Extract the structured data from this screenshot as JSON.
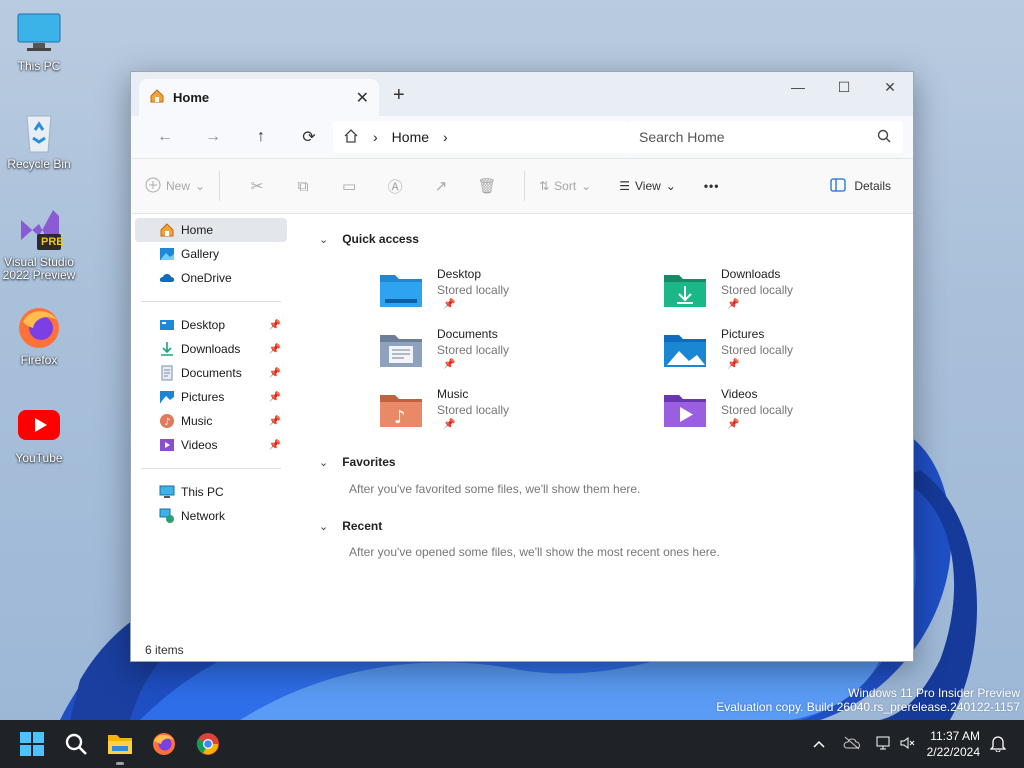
{
  "desktop": {
    "icons": [
      {
        "label": "This PC",
        "icon": "monitor-icon"
      },
      {
        "label": "Recycle Bin",
        "icon": "recycle-bin-icon"
      },
      {
        "label": "Visual Studio 2022 Preview",
        "icon": "visual-studio-icon",
        "badge": "PRE"
      },
      {
        "label": "Firefox",
        "icon": "firefox-icon"
      },
      {
        "label": "YouTube",
        "icon": "youtube-icon"
      }
    ],
    "watermark": {
      "line1": "Windows 11 Pro Insider Preview",
      "line2": "Evaluation copy. Build 26040.rs_prerelease.240122-1157"
    }
  },
  "window": {
    "tab": {
      "label": "Home",
      "icon": "home-icon",
      "close": "✕"
    },
    "new_tab": "+",
    "controls": {
      "minimize": "—",
      "maximize": "☐",
      "close": "✕"
    },
    "address": {
      "back": "←",
      "forward": "→",
      "up": "↑",
      "refresh": "⟳",
      "crumb": "Home",
      "sep": "›",
      "search_placeholder": "Search Home"
    },
    "toolbar": {
      "new_label": "New",
      "sort_label": "Sort",
      "view_label": "View",
      "more": "•••",
      "details_label": "Details"
    },
    "sidebar": {
      "top": [
        {
          "label": "Home",
          "icon": "home-icon",
          "active": true
        },
        {
          "label": "Gallery",
          "icon": "gallery-icon"
        },
        {
          "label": "OneDrive",
          "icon": "onedrive-icon"
        }
      ],
      "pinned": [
        {
          "label": "Desktop",
          "icon": "desktop-folder-icon"
        },
        {
          "label": "Downloads",
          "icon": "download-icon"
        },
        {
          "label": "Documents",
          "icon": "documents-icon"
        },
        {
          "label": "Pictures",
          "icon": "pictures-icon"
        },
        {
          "label": "Music",
          "icon": "music-icon"
        },
        {
          "label": "Videos",
          "icon": "videos-icon"
        }
      ],
      "bottom": [
        {
          "label": "This PC",
          "icon": "monitor-icon"
        },
        {
          "label": "Network",
          "icon": "network-icon"
        }
      ]
    },
    "main": {
      "quick_access": {
        "title": "Quick access",
        "items": [
          {
            "name": "Desktop",
            "sub": "Stored locally",
            "color": "#1e88d6"
          },
          {
            "name": "Downloads",
            "sub": "Stored locally",
            "color": "#1aa37a"
          },
          {
            "name": "Documents",
            "sub": "Stored locally",
            "color": "#7a8fa8"
          },
          {
            "name": "Pictures",
            "sub": "Stored locally",
            "color": "#1a86d4"
          },
          {
            "name": "Music",
            "sub": "Stored locally",
            "color": "#e07a5a"
          },
          {
            "name": "Videos",
            "sub": "Stored locally",
            "color": "#8a4fd0"
          }
        ]
      },
      "favorites": {
        "title": "Favorites",
        "empty": "After you've favorited some files, we'll show them here."
      },
      "recent": {
        "title": "Recent",
        "empty": "After you've opened some files, we'll show the most recent ones here."
      }
    },
    "status": "6 items"
  },
  "taskbar": {
    "time": "11:37 AM",
    "date": "2/22/2024"
  }
}
